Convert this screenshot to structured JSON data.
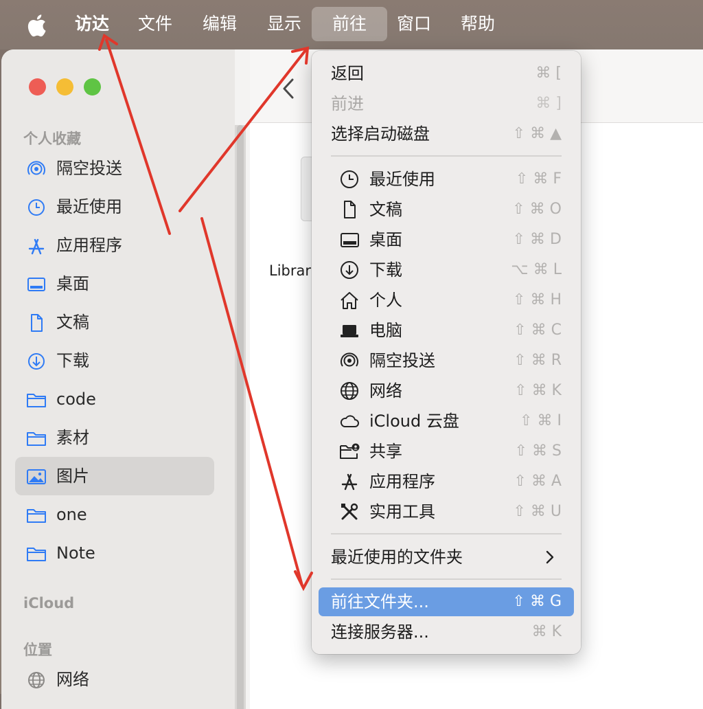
{
  "menubar": {
    "apple_icon": "apple-logo-icon",
    "items": [
      {
        "label": "访达"
      },
      {
        "label": "文件"
      },
      {
        "label": "编辑"
      },
      {
        "label": "显示"
      },
      {
        "label": "前往"
      },
      {
        "label": "窗口"
      },
      {
        "label": "帮助"
      }
    ]
  },
  "sidebar": {
    "favorites_title": "个人收藏",
    "items": [
      {
        "label": "隔空投送",
        "icon": "airdrop-icon"
      },
      {
        "label": "最近使用",
        "icon": "clock-icon"
      },
      {
        "label": "应用程序",
        "icon": "apps-icon"
      },
      {
        "label": "桌面",
        "icon": "desktop-icon"
      },
      {
        "label": "文稿",
        "icon": "document-icon"
      },
      {
        "label": "下载",
        "icon": "download-icon"
      },
      {
        "label": "code",
        "icon": "folder-icon"
      },
      {
        "label": "素材",
        "icon": "folder-icon"
      },
      {
        "label": "图片",
        "icon": "photos-icon"
      },
      {
        "label": "one",
        "icon": "folder-icon"
      },
      {
        "label": "Note",
        "icon": "folder-icon"
      }
    ],
    "selected_item": "图片",
    "icloud_title": "iCloud",
    "locations_title": "位置",
    "location_items": [
      {
        "label": "网络",
        "icon": "globe-icon"
      }
    ]
  },
  "content": {
    "file_label": "Librar"
  },
  "go_menu": {
    "top_items": [
      {
        "label": "返回",
        "shortcut": "⌘ [",
        "disabled": false
      },
      {
        "label": "前进",
        "shortcut": "⌘ ]",
        "disabled": true
      },
      {
        "label": "选择启动磁盘",
        "shortcut": "⇧ ⌘ ▲",
        "disabled": false
      }
    ],
    "location_items": [
      {
        "label": "最近使用",
        "shortcut": "⇧ ⌘ F",
        "icon": "clock-icon"
      },
      {
        "label": "文稿",
        "shortcut": "⇧ ⌘ O",
        "icon": "document-icon"
      },
      {
        "label": "桌面",
        "shortcut": "⇧ ⌘ D",
        "icon": "desktop-icon"
      },
      {
        "label": "下载",
        "shortcut": "⌥ ⌘ L",
        "icon": "download-icon"
      },
      {
        "label": "个人",
        "shortcut": "⇧ ⌘ H",
        "icon": "home-icon"
      },
      {
        "label": "电脑",
        "shortcut": "⇧ ⌘ C",
        "icon": "laptop-icon"
      },
      {
        "label": "隔空投送",
        "shortcut": "⇧ ⌘ R",
        "icon": "airdrop-icon"
      },
      {
        "label": "网络",
        "shortcut": "⇧ ⌘ K",
        "icon": "globe-icon"
      },
      {
        "label": "iCloud 云盘",
        "shortcut": "⇧ ⌘ I",
        "icon": "cloud-icon"
      },
      {
        "label": "共享",
        "shortcut": "⇧ ⌘ S",
        "icon": "shared-folder-icon"
      },
      {
        "label": "应用程序",
        "shortcut": "⇧ ⌘ A",
        "icon": "apps-icon"
      },
      {
        "label": "实用工具",
        "shortcut": "⇧ ⌘ U",
        "icon": "tools-icon"
      }
    ],
    "recent_folders": "最近使用的文件夹",
    "goto_folder": {
      "label": "前往文件夹...",
      "shortcut": "⇧ ⌘ G"
    },
    "connect_server": {
      "label": "连接服务器...",
      "shortcut": "⌘ K"
    }
  },
  "colors": {
    "highlight": "#6a9de3",
    "annotation_arrow": "#e0372b",
    "sidebar_icon": "#2f7bf5"
  }
}
